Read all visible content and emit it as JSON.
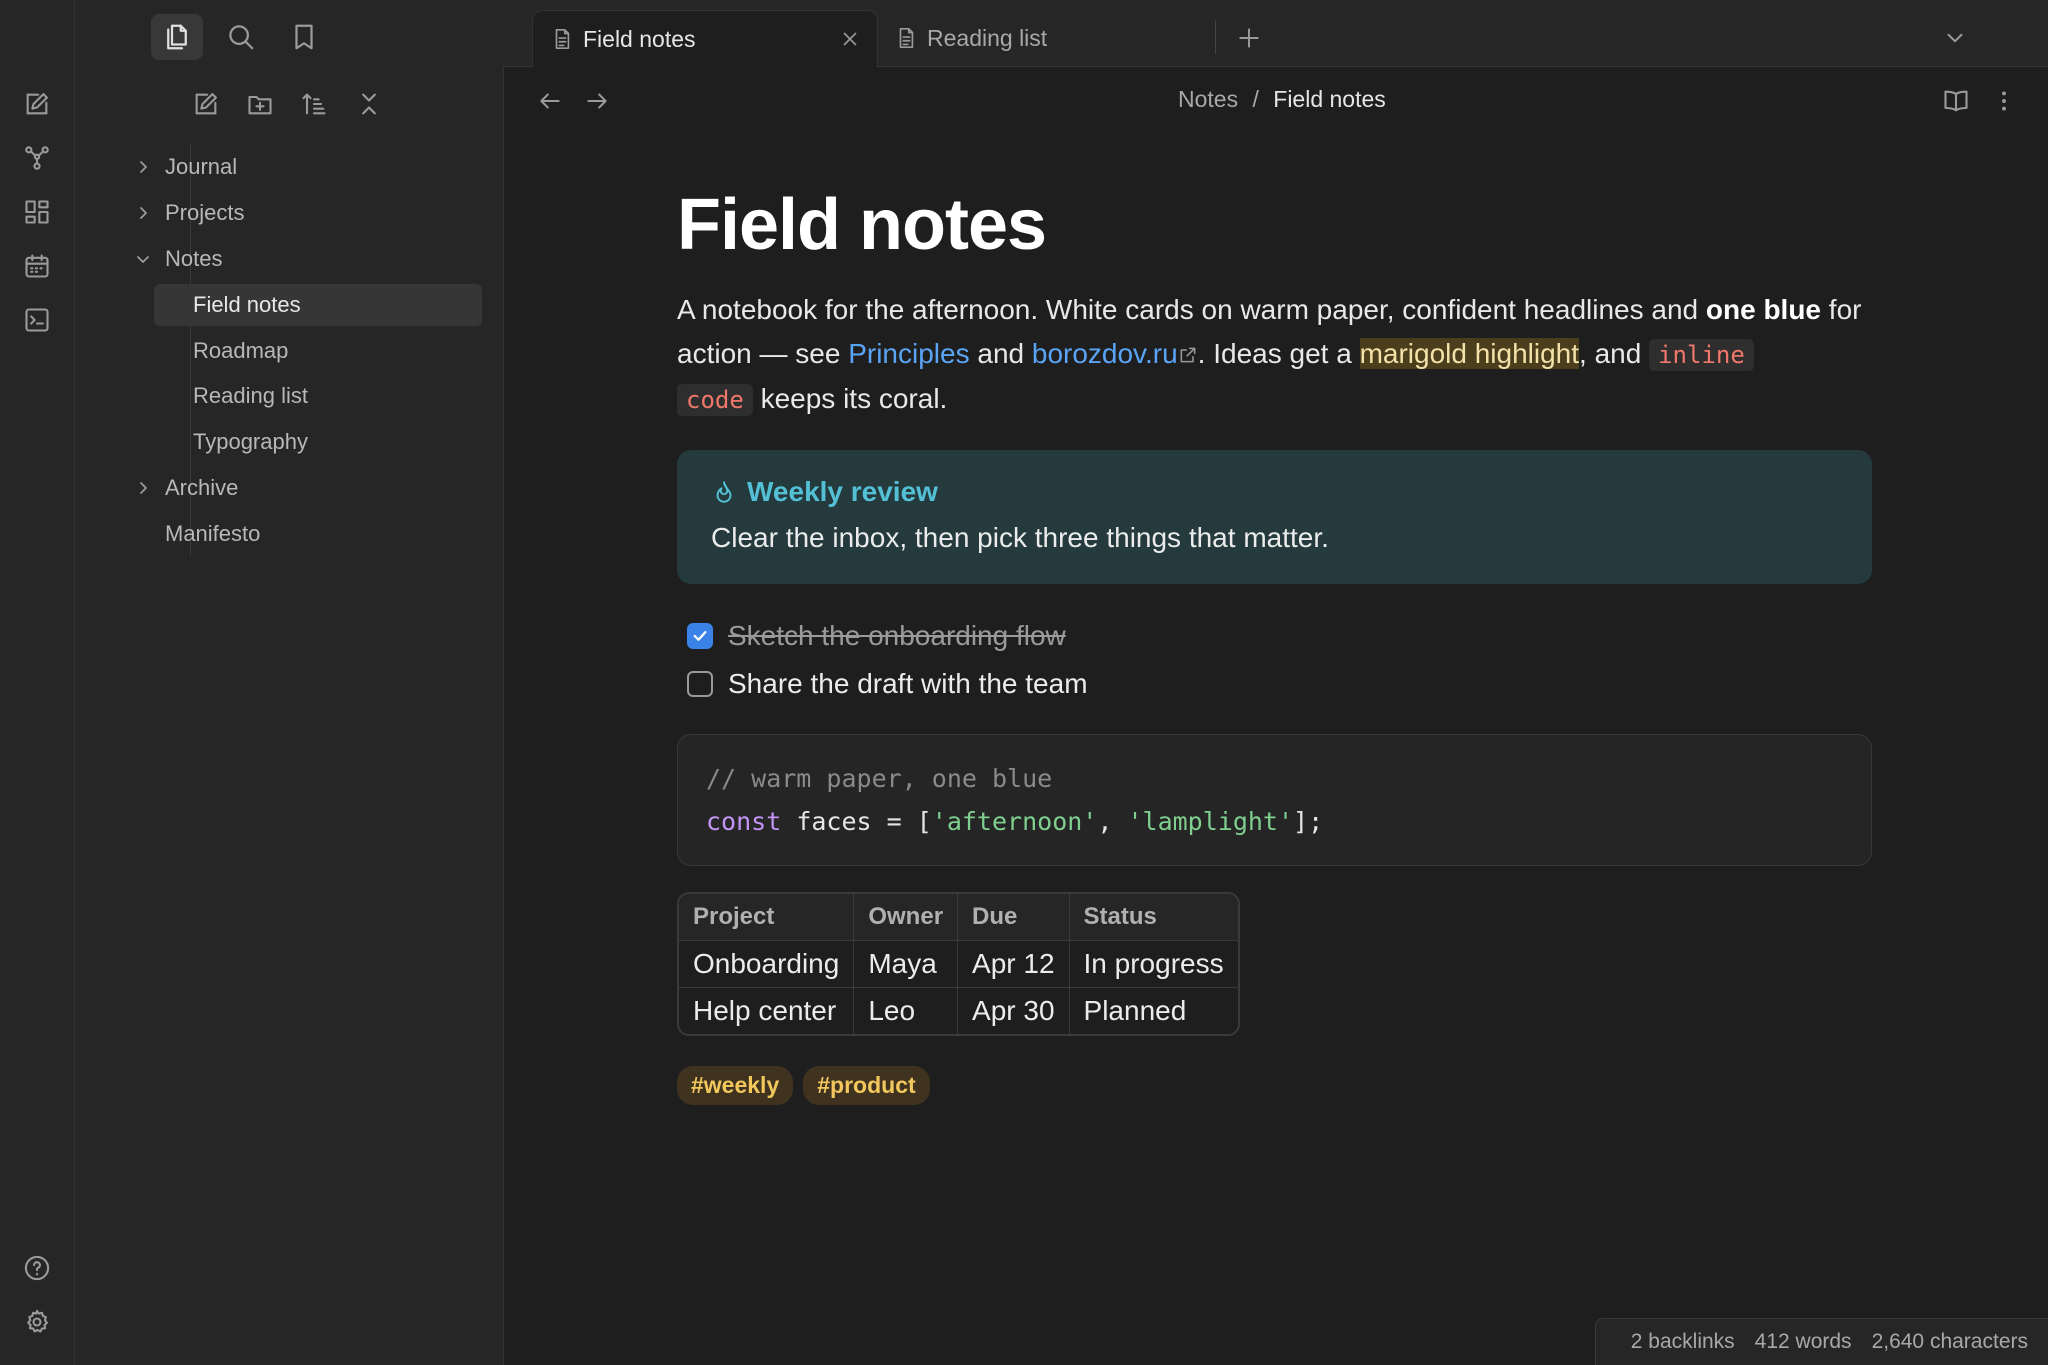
{
  "tabs": [
    {
      "label": "Field notes",
      "active": true
    },
    {
      "label": "Reading list",
      "active": false
    }
  ],
  "breadcrumb": {
    "parent": "Notes",
    "separator": "/",
    "current": "Field notes"
  },
  "sidebar": {
    "tree": [
      {
        "label": "Journal"
      },
      {
        "label": "Projects"
      },
      {
        "label": "Notes"
      },
      {
        "label": "Field notes"
      },
      {
        "label": "Roadmap"
      },
      {
        "label": "Reading list"
      },
      {
        "label": "Typography"
      },
      {
        "label": "Archive"
      },
      {
        "label": "Manifesto"
      }
    ]
  },
  "note": {
    "title": "Field notes",
    "para": {
      "t1": "A notebook for the afternoon. White cards on warm paper, confident headlines and ",
      "bold": "one blue",
      "t2": " for action — see ",
      "link1": "Principles",
      "t3": " and ",
      "link2": "borozdov.ru",
      "t4": ". Ideas get a ",
      "highlight": "marigold highlight",
      "t5": ", and ",
      "code1": "inline",
      "code2": "code",
      "t6": " keeps its coral."
    },
    "callout": {
      "title": "Weekly review",
      "body": "Clear the inbox, then pick three things that matter."
    },
    "tasks": [
      {
        "text": "Sketch the onboarding flow",
        "done": true
      },
      {
        "text": "Share the draft with the team",
        "done": false
      }
    ],
    "code": {
      "comment": "// warm paper, one blue",
      "kw": "const",
      "ident": " faces = [",
      "s1": "'afternoon'",
      "comma": ", ",
      "s2": "'lamplight'",
      "end": "];"
    },
    "table": {
      "headers": [
        "Project",
        "Owner",
        "Due",
        "Status"
      ],
      "rows": [
        [
          "Onboarding",
          "Maya",
          "Apr 12",
          "In progress"
        ],
        [
          "Help center",
          "Leo",
          "Apr 30",
          "Planned"
        ]
      ]
    },
    "tags": [
      "#weekly",
      "#product"
    ]
  },
  "status": {
    "backlinks": "2 backlinks",
    "words": "412 words",
    "chars": "2,640 characters"
  },
  "colors": {
    "accent": "#5aa4f5",
    "callout": "#53c0d5",
    "highlight": "#4a3e1c",
    "tag": "#f2c75c",
    "code": "#f0786b"
  }
}
